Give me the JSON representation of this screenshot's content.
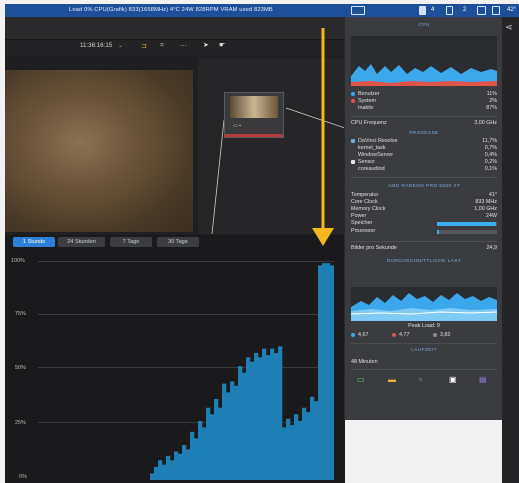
{
  "menubar": {
    "status_text": "Load 0%  CPU(Grafik) 833(1658MHz)  4°C  24W  828RPM  VRAM used 823MB",
    "right_items": [
      "4",
      "2",
      "42°"
    ]
  },
  "toolbar": {
    "timecode": "11:36:16:15",
    "chevron": "⌄"
  },
  "usage_chart": {
    "tabs": [
      "1 Stunde",
      "24 Stunden",
      "7 Tage",
      "30 Tage"
    ],
    "active_tab": 0,
    "y_ticks": [
      "100%",
      "75%",
      "50%",
      "25%",
      "0%"
    ]
  },
  "chart_data": {
    "type": "area",
    "ylim": [
      0,
      100
    ],
    "y_ticks": [
      "100%",
      "75%",
      "50%",
      "25%",
      "0%"
    ],
    "values": [
      0,
      0,
      0,
      0,
      0,
      0,
      0,
      0,
      0,
      0,
      0,
      0,
      0,
      0,
      0,
      0,
      0,
      0,
      0,
      0,
      0,
      0,
      0,
      0,
      0,
      0,
      0,
      0,
      3,
      6,
      9,
      7,
      11,
      9,
      13,
      12,
      16,
      14,
      22,
      19,
      27,
      24,
      33,
      30,
      37,
      33,
      44,
      40,
      45,
      43,
      52,
      49,
      56,
      54,
      58,
      56,
      60,
      57,
      60,
      58,
      61,
      24,
      28,
      25,
      30,
      27,
      33,
      31,
      38,
      36,
      98,
      99,
      99,
      98
    ]
  },
  "panel": {
    "cpu": {
      "title": "CPU",
      "legend": [
        {
          "label": "Benutzer",
          "value": "11%",
          "color": "#3aa8ea"
        },
        {
          "label": "System",
          "value": "2%",
          "color": "#e0524a"
        },
        {
          "label": "Inaktiv",
          "value": "87%",
          "color": "#6c6c6c"
        }
      ],
      "frequency_label": "CPU Frequenz",
      "frequency_value": "3,00 GHz"
    },
    "processes": {
      "title": "PROZESSE",
      "items": [
        {
          "name": "DaVinci Resolve",
          "value": "11,7%"
        },
        {
          "name": "kernel_task",
          "value": "0,7%"
        },
        {
          "name": "WindowServer",
          "value": "0,4%"
        },
        {
          "name": "Sensor",
          "value": "0,2%"
        },
        {
          "name": "coreaudiod",
          "value": "0,1%"
        }
      ]
    },
    "gpu": {
      "title": "AMD RADEON PRO 5500 XT",
      "rows": [
        {
          "label": "Temperatur",
          "value": "41°"
        },
        {
          "label": "Core Clock",
          "value": "833 MHz"
        },
        {
          "label": "Memory Clock",
          "value": "1,00 GHz"
        },
        {
          "label": "Power",
          "value": "24W"
        }
      ],
      "speicher_label": "Speicher",
      "speicher_level": 0.98,
      "prozessor_label": "Prozessor",
      "prozessor_level": 0.04,
      "fps_label": "Bilder pro Sekunde",
      "fps_value": "24,9"
    },
    "avg_load": {
      "title": "DURCHSCHNITTLICHE LAST",
      "peak_label": "Peak Load: 9",
      "values": [
        {
          "value": "4,67",
          "color": "#3aa8ea"
        },
        {
          "value": "4,77",
          "color": "#e0524a"
        },
        {
          "value": "3,82",
          "color": "#8a8a8a"
        }
      ]
    },
    "uptime": {
      "title": "LAUFZEIT",
      "value": "48 Minuten"
    },
    "dock_icons": [
      "messages-icon",
      "folder-icon",
      "terminal-icon",
      "calendar-icon",
      "finder-icon"
    ]
  }
}
